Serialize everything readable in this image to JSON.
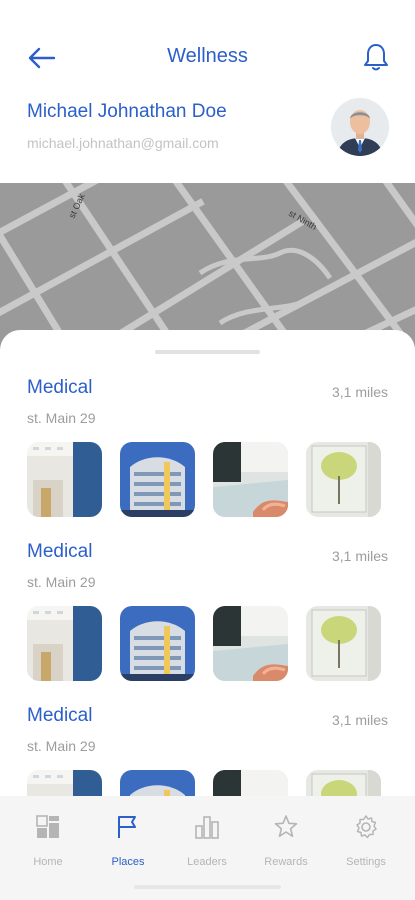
{
  "header": {
    "title": "Wellness",
    "back_icon": "arrow-left-icon",
    "bell_icon": "bell-icon"
  },
  "profile": {
    "name": "Michael Johnathan Doe",
    "email": "michael.johnathan@gmail.com",
    "avatar_icon": "user-avatar"
  },
  "map": {
    "street_labels": [
      "st Oak",
      "st Ninth"
    ]
  },
  "places": [
    {
      "name": "Medical",
      "address": "st. Main 29",
      "distance": "3,1 miles",
      "photos": [
        "lobby-photo",
        "building-photo",
        "pool-photo",
        "tree-art-photo"
      ]
    },
    {
      "name": "Medical",
      "address": "st. Main 29",
      "distance": "3,1 miles",
      "photos": [
        "lobby-photo",
        "building-photo",
        "pool-photo",
        "tree-art-photo"
      ]
    },
    {
      "name": "Medical",
      "address": "st. Main 29",
      "distance": "3,1 miles",
      "photos": [
        "lobby-photo",
        "building-photo",
        "pool-photo",
        "tree-art-photo"
      ]
    }
  ],
  "tabbar": {
    "items": [
      {
        "label": "Home",
        "icon": "grid-icon",
        "active": false
      },
      {
        "label": "Places",
        "icon": "flag-icon",
        "active": true
      },
      {
        "label": "Leaders",
        "icon": "bar-chart-icon",
        "active": false
      },
      {
        "label": "Rewards",
        "icon": "star-icon",
        "active": false
      },
      {
        "label": "Settings",
        "icon": "gear-icon",
        "active": false
      }
    ]
  },
  "colors": {
    "accent": "#2b5fc9",
    "muted_text": "#9d9d9d",
    "map_background": "#9a9a9a",
    "tabbar_background": "#f5f5f5"
  }
}
